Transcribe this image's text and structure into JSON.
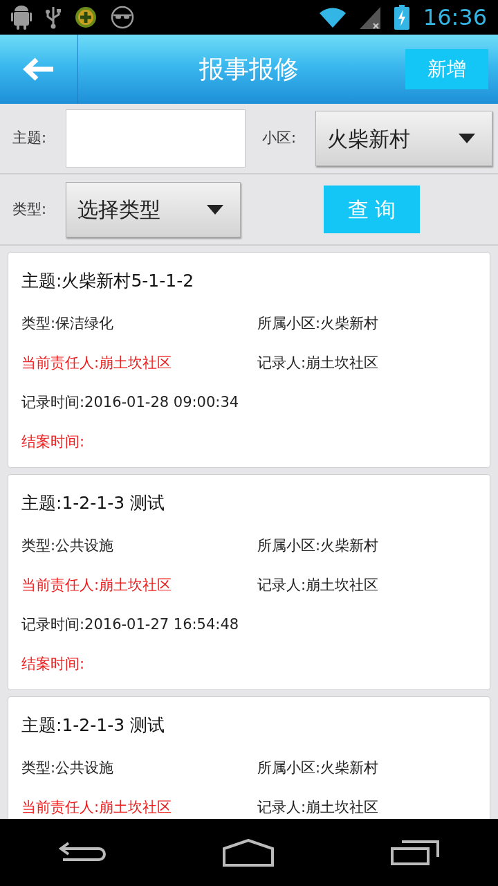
{
  "status_bar": {
    "time": "16:36"
  },
  "header": {
    "title": "报事报修",
    "add_button": "新增"
  },
  "filters": {
    "subject_label": "主题:",
    "community_label": "小区:",
    "community_value": "火柴新村",
    "type_label": "类型:",
    "type_value": "选择类型",
    "query_button": "查 询"
  },
  "records": [
    {
      "title": "主题:火柴新村5-1-1-2",
      "type": "类型:保洁绿化",
      "community": "所属小区:火柴新村",
      "responsible": "当前责任人:崩土坎社区",
      "recorder": "记录人:崩土坎社区",
      "record_time": "记录时间:2016-01-28 09:00:34",
      "close_time": "结案时间:"
    },
    {
      "title": "主题:1-2-1-3 测试",
      "type": "类型:公共设施",
      "community": "所属小区:火柴新村",
      "responsible": "当前责任人:崩土坎社区",
      "recorder": "记录人:崩土坎社区",
      "record_time": "记录时间:2016-01-27 16:54:48",
      "close_time": "结案时间:"
    },
    {
      "title": "主题:1-2-1-3 测试",
      "type": "类型:公共设施",
      "community": "所属小区:火柴新村",
      "responsible": "当前责任人:崩土坎社区",
      "recorder": "记录人:崩土坎社区"
    }
  ]
}
